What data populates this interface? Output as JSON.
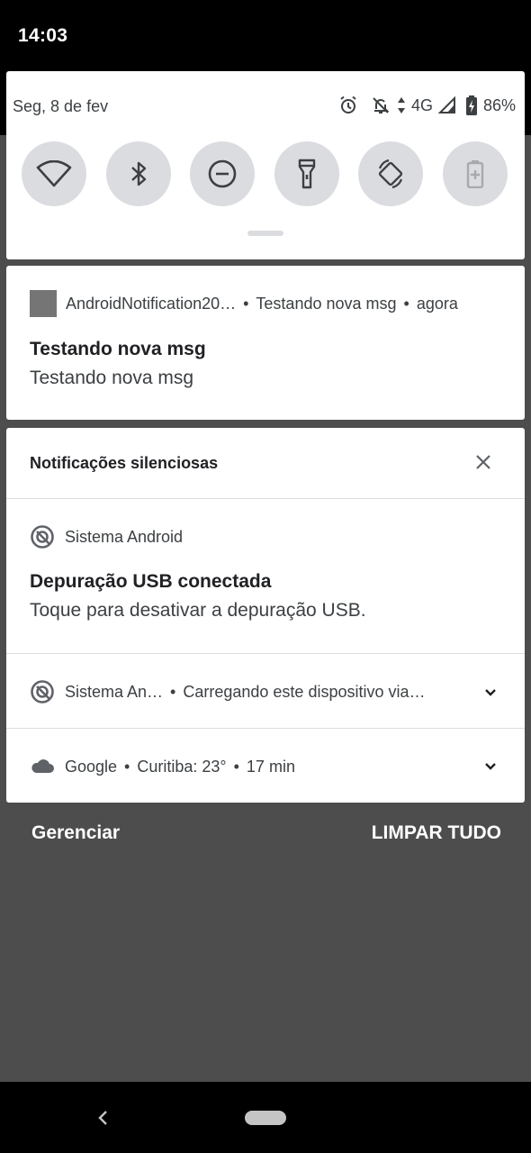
{
  "status_bar": {
    "time": "14:03"
  },
  "quick_settings": {
    "date": "Seg, 8 de fev",
    "network": "4G",
    "battery": "86%",
    "tiles": [
      {
        "icon": "wifi-icon"
      },
      {
        "icon": "bluetooth-icon"
      },
      {
        "icon": "do-not-disturb-icon"
      },
      {
        "icon": "flashlight-icon"
      },
      {
        "icon": "auto-rotate-icon"
      },
      {
        "icon": "battery-saver-icon"
      }
    ]
  },
  "notification1": {
    "app": "AndroidNotification20…",
    "subtext": "Testando nova msg",
    "time": "agora",
    "title": "Testando nova msg",
    "text": "Testando nova msg"
  },
  "silent": {
    "header": "Notificações silenciosas",
    "items": [
      {
        "app": "Sistema Android",
        "title": "Depuração USB conectada",
        "text": "Toque para desativar a depuração USB."
      },
      {
        "app": "Sistema An…",
        "summary": "Carregando este dispositivo via…"
      },
      {
        "app": "Google",
        "summary": "Curitiba: 23°",
        "time": "17 min"
      }
    ]
  },
  "footer": {
    "manage": "Gerenciar",
    "clear_all": "LIMPAR TUDO"
  },
  "colors": {
    "panel_bg": "#ffffff",
    "scrim": "#4d4d4d",
    "tile_bg": "#dadce0",
    "icon": "#3c4043"
  }
}
